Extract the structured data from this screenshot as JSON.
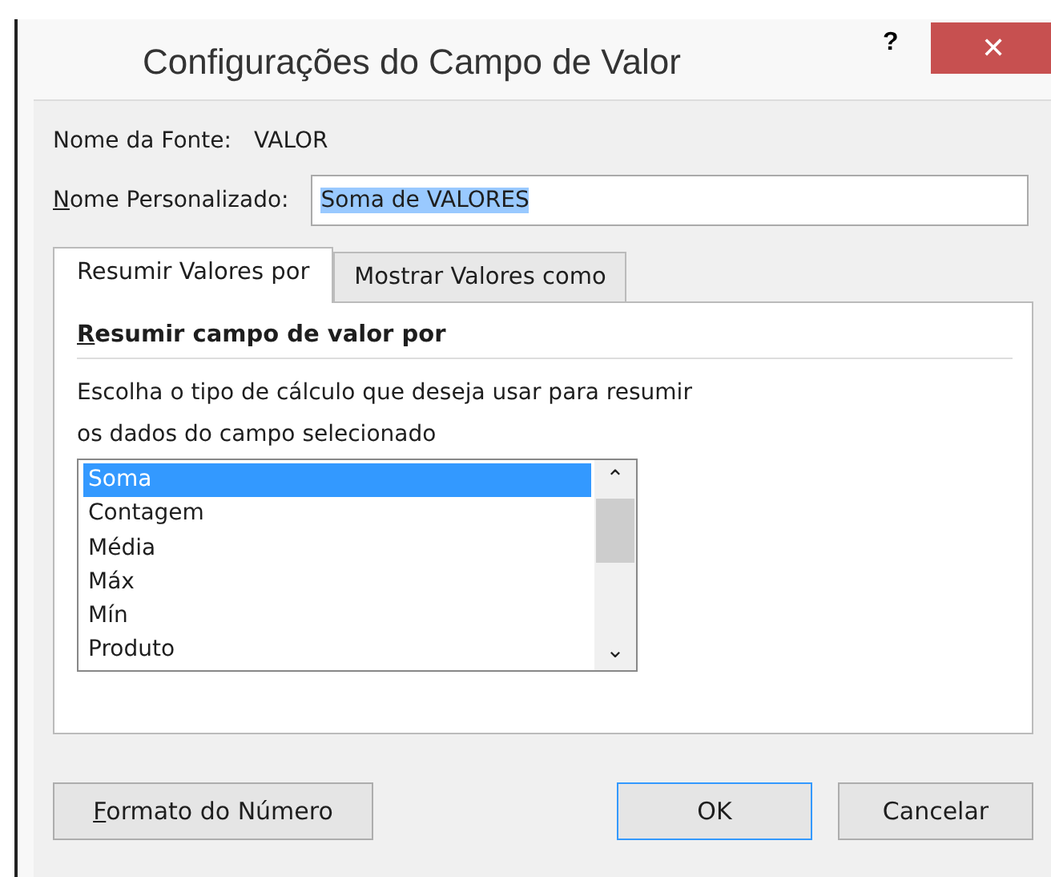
{
  "window": {
    "title": "Configurações do Campo de Valor",
    "help": "?",
    "close": "✕"
  },
  "source_name": {
    "label": "Nome da Fonte:",
    "value": "VALOR"
  },
  "custom_name": {
    "label": "Nome Personalizado:",
    "mnemonic": true,
    "value": "Soma de VALORES",
    "text_selected": true
  },
  "tabs": [
    {
      "label": "Resumir Valores por",
      "selected": true
    },
    {
      "label": "Mostrar Valores como",
      "selected": false
    }
  ],
  "section": {
    "heading": "Resumir campo de valor por",
    "mnemonic": true,
    "description": [
      "Escolha o tipo de cálculo que deseja usar para resumir",
      "os dados do campo selecionado"
    ]
  },
  "list": {
    "items": [
      {
        "label": "Soma",
        "selected": true
      },
      {
        "label": "Contagem",
        "selected": false
      },
      {
        "label": "Média",
        "selected": false
      },
      {
        "label": "Máx",
        "selected": false
      },
      {
        "label": "Mín",
        "selected": false
      },
      {
        "label": "Produto",
        "selected": false
      }
    ],
    "scroll_up": "⌃",
    "scroll_down": "⌄"
  },
  "buttons": [
    {
      "label": "Formato do Número",
      "mnemonic": true,
      "kind": "left",
      "default": false
    },
    {
      "label": "OK",
      "mnemonic": false,
      "kind": "right",
      "default": true
    },
    {
      "label": "Cancelar",
      "mnemonic": false,
      "kind": "right",
      "default": false
    }
  ]
}
